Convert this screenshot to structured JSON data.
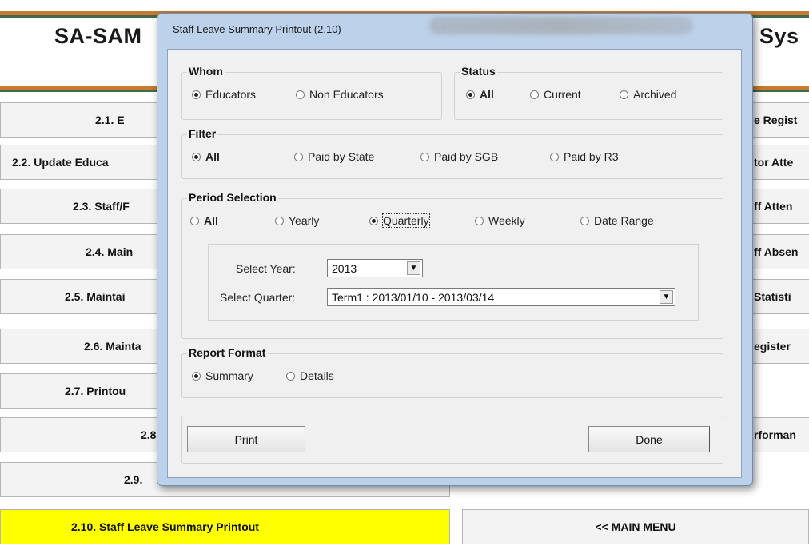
{
  "app": {
    "title_left": "SA-SAM",
    "title_right": "Sys",
    "colors": {
      "accent_line": "#c87a2e",
      "green_line": "#3f6a4f",
      "active_button": "#ffff00"
    }
  },
  "menu_left": [
    {
      "label": "2.1.  E"
    },
    {
      "label": "2.2.  Update Educa"
    },
    {
      "label": "2.3.  Staff/F"
    },
    {
      "label": "2.4.  Main"
    },
    {
      "label": "2.5.  Maintai"
    },
    {
      "label": "2.6.  Mainta"
    },
    {
      "label": "2.7.  Printou"
    },
    {
      "label": "2.8"
    },
    {
      "label": "2.9."
    },
    {
      "label": "2.10.  Staff Leave Summary Printout"
    }
  ],
  "menu_right": [
    {
      "label": "e Regist"
    },
    {
      "label": "tor Atte"
    },
    {
      "label": "ff Atten"
    },
    {
      "label": "ff Absen"
    },
    {
      "label": "Statisti"
    },
    {
      "label": "egister"
    },
    {
      "label": ""
    },
    {
      "label": "rforman"
    },
    {
      "label": ""
    }
  ],
  "main_menu_label": "<< MAIN MENU",
  "dialog": {
    "title": "Staff Leave Summary Printout (2.10)",
    "whom": {
      "legend": "Whom",
      "options": [
        {
          "label": "Educators",
          "checked": true
        },
        {
          "label": "Non Educators",
          "checked": false
        }
      ]
    },
    "status": {
      "legend": "Status",
      "options": [
        {
          "label": "All",
          "checked": true
        },
        {
          "label": "Current",
          "checked": false
        },
        {
          "label": "Archived",
          "checked": false
        }
      ]
    },
    "filter": {
      "legend": "Filter",
      "options": [
        {
          "label": "All",
          "checked": true
        },
        {
          "label": "Paid by State",
          "checked": false
        },
        {
          "label": "Paid by SGB",
          "checked": false
        },
        {
          "label": "Paid by R3",
          "checked": false
        }
      ]
    },
    "period": {
      "legend": "Period Selection",
      "options": [
        {
          "label": "All",
          "checked": false
        },
        {
          "label": "Yearly",
          "checked": false
        },
        {
          "label": "Quarterly",
          "checked": true
        },
        {
          "label": "Weekly",
          "checked": false
        },
        {
          "label": "Date Range",
          "checked": false
        }
      ],
      "select_year_label": "Select Year:",
      "select_year_value": "2013",
      "select_quarter_label": "Select Quarter:",
      "select_quarter_value": "Term1 : 2013/01/10 - 2013/03/14"
    },
    "report_format": {
      "legend": "Report Format",
      "options": [
        {
          "label": "Summary",
          "checked": true
        },
        {
          "label": "Details",
          "checked": false
        }
      ]
    },
    "print_label": "Print",
    "done_label": "Done"
  }
}
